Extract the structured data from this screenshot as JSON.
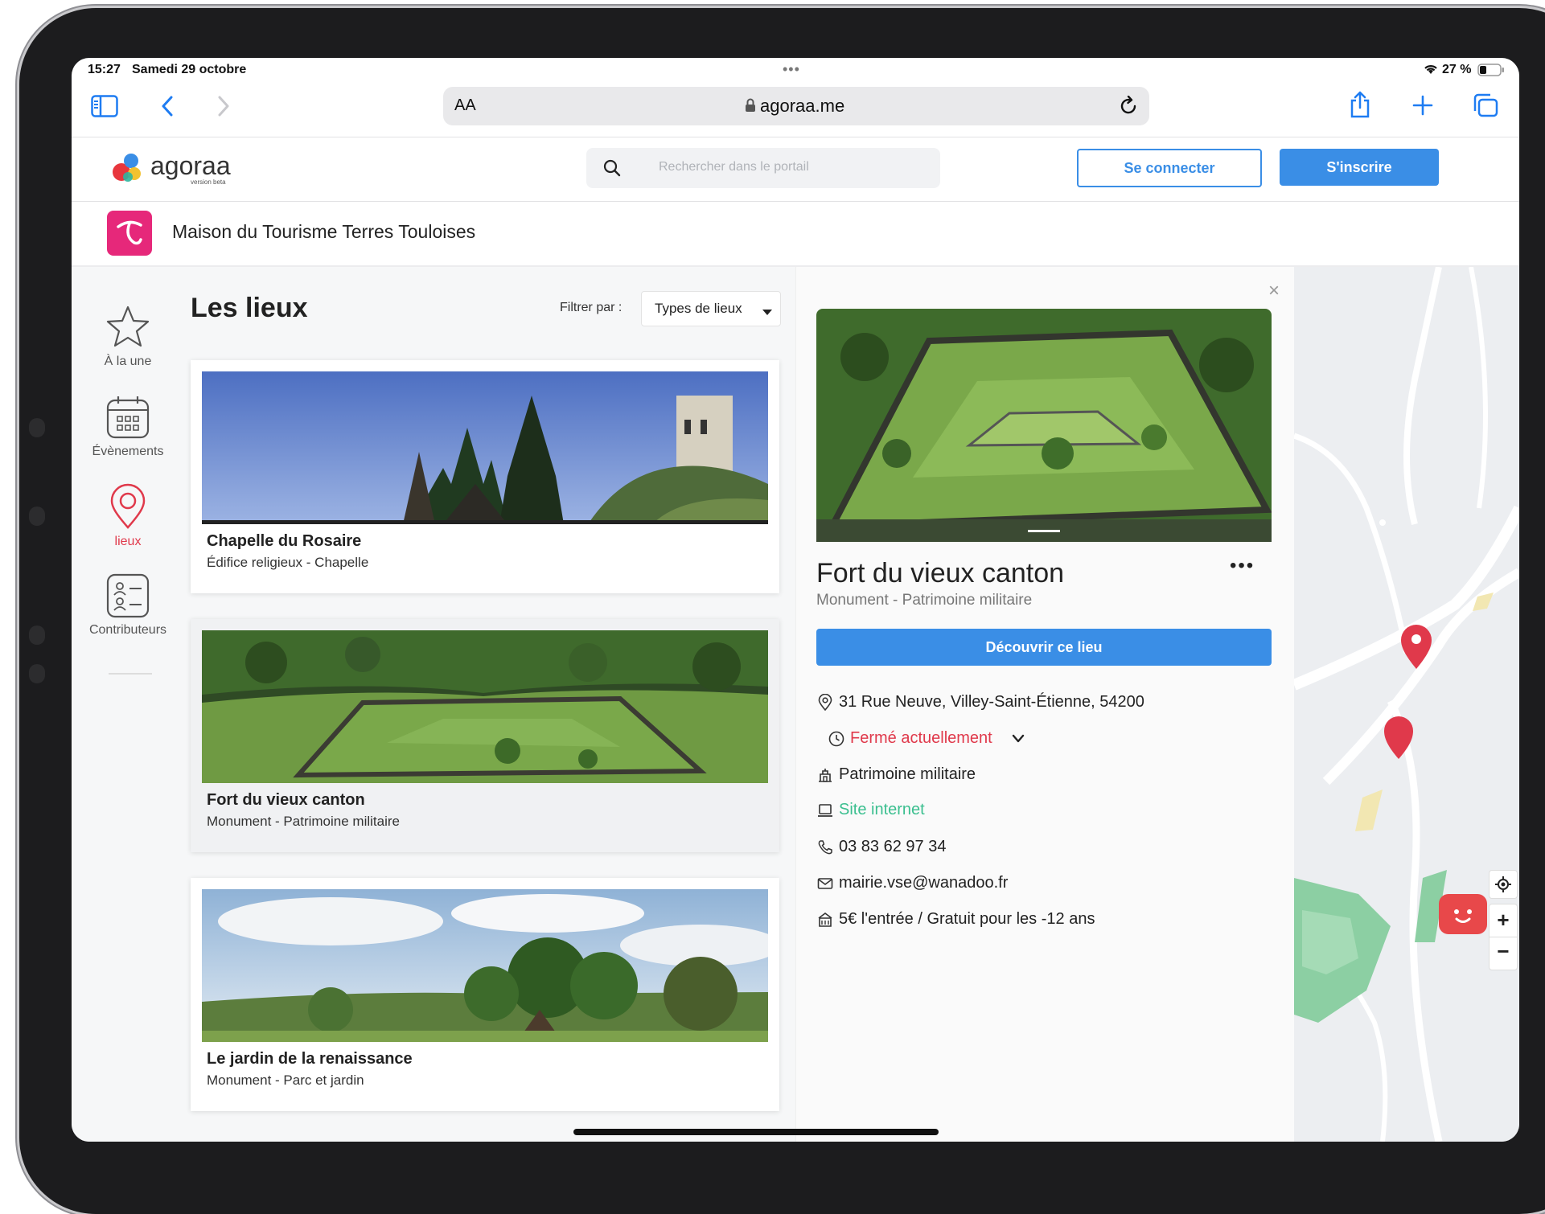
{
  "status_bar": {
    "time": "15:27",
    "date": "Samedi 29 octobre",
    "battery": "27 %"
  },
  "browser": {
    "text_size_label": "AA",
    "url": "agoraa.me"
  },
  "site": {
    "logo_text": "agoraa",
    "logo_sub": "version beta",
    "search_placeholder": "Rechercher dans le portail",
    "login_label": "Se connecter",
    "signup_label": "S'inscrire",
    "org_name": "Maison du Tourisme Terres Touloises"
  },
  "nav": {
    "items": [
      {
        "label": "À la une",
        "icon": "star-icon"
      },
      {
        "label": "Évènements",
        "icon": "calendar-icon"
      },
      {
        "label": "lieux",
        "icon": "map-pin-icon",
        "active": true
      },
      {
        "label": "Contributeurs",
        "icon": "contacts-icon"
      }
    ]
  },
  "list": {
    "title": "Les lieux",
    "filter_label": "Filtrer par :",
    "filter_value": "Types de lieux",
    "places": [
      {
        "name": "Chapelle du Rosaire",
        "category": "Édifice religieux - Chapelle"
      },
      {
        "name": "Fort du vieux canton",
        "category": "Monument - Patrimoine militaire"
      },
      {
        "name": "Le jardin de la renaissance",
        "category": "Monument - Parc et jardin"
      }
    ]
  },
  "detail": {
    "title": "Fort du vieux canton",
    "category": "Monument - Patrimoine militaire",
    "cta_label": "Découvrir ce lieu",
    "address": "31 Rue Neuve, Villey-Saint-Étienne, 54200",
    "hours_status": "Fermé actuellement",
    "type": "Patrimoine militaire",
    "website_label": "Site internet",
    "phone": "03 83 62 97 34",
    "email": "mairie.vse@wanadoo.fr",
    "price": "5€ l'entrée / Gratuit pour les -12 ans"
  },
  "map": {
    "zoom_in": "+",
    "zoom_out": "−"
  },
  "colors": {
    "accent": "#3a8ee6",
    "active": "#e0394b",
    "closed": "#e0394b",
    "link": "#3bbf8f"
  }
}
